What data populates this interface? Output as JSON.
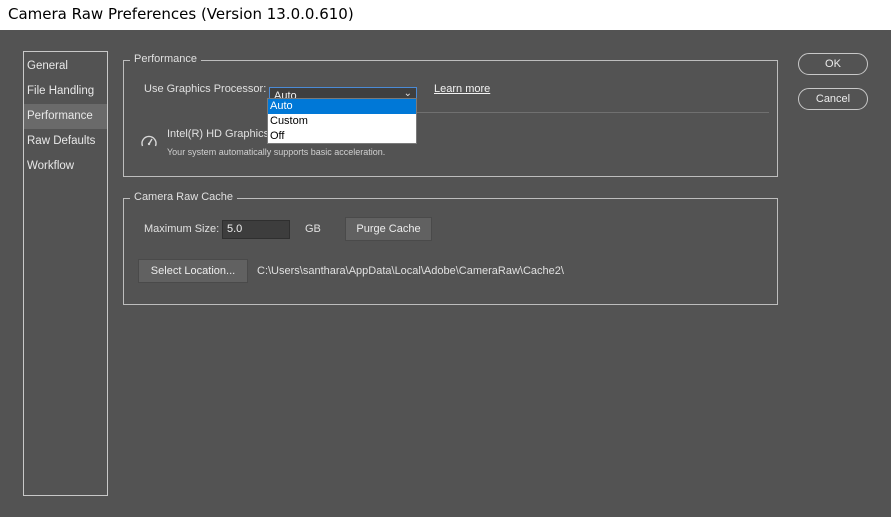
{
  "window": {
    "title": "Camera Raw Preferences  (Version 13.0.0.610)"
  },
  "sidebar": {
    "items": [
      {
        "label": "General"
      },
      {
        "label": "File Handling"
      },
      {
        "label": "Performance",
        "selected": true
      },
      {
        "label": "Raw Defaults"
      },
      {
        "label": "Workflow"
      }
    ]
  },
  "performance": {
    "legend": "Performance",
    "gpu_label": "Use Graphics Processor:",
    "gpu_value": "Auto",
    "learn_more": "Learn more",
    "dropdown_options": [
      "Auto",
      "Custom",
      "Off"
    ],
    "highlighted_option": "Auto",
    "gpu_name": "Intel(R) HD Graphics",
    "gpu_status": "Your system automatically supports basic acceleration.",
    "gpu_icon": "speedometer-icon"
  },
  "cache": {
    "legend": "Camera Raw Cache",
    "max_size_label": "Maximum Size:",
    "max_size_value": "5.0",
    "unit": "GB",
    "purge_button": "Purge Cache",
    "select_location_button": "Select Location...",
    "location_path": "C:\\Users\\santhara\\AppData\\Local\\Adobe\\CameraRaw\\Cache2\\"
  },
  "buttons": {
    "ok": "OK",
    "cancel": "Cancel"
  },
  "colors": {
    "background": "#535353",
    "selection": "#0078d7",
    "focus_border": "#4b8bd6"
  }
}
